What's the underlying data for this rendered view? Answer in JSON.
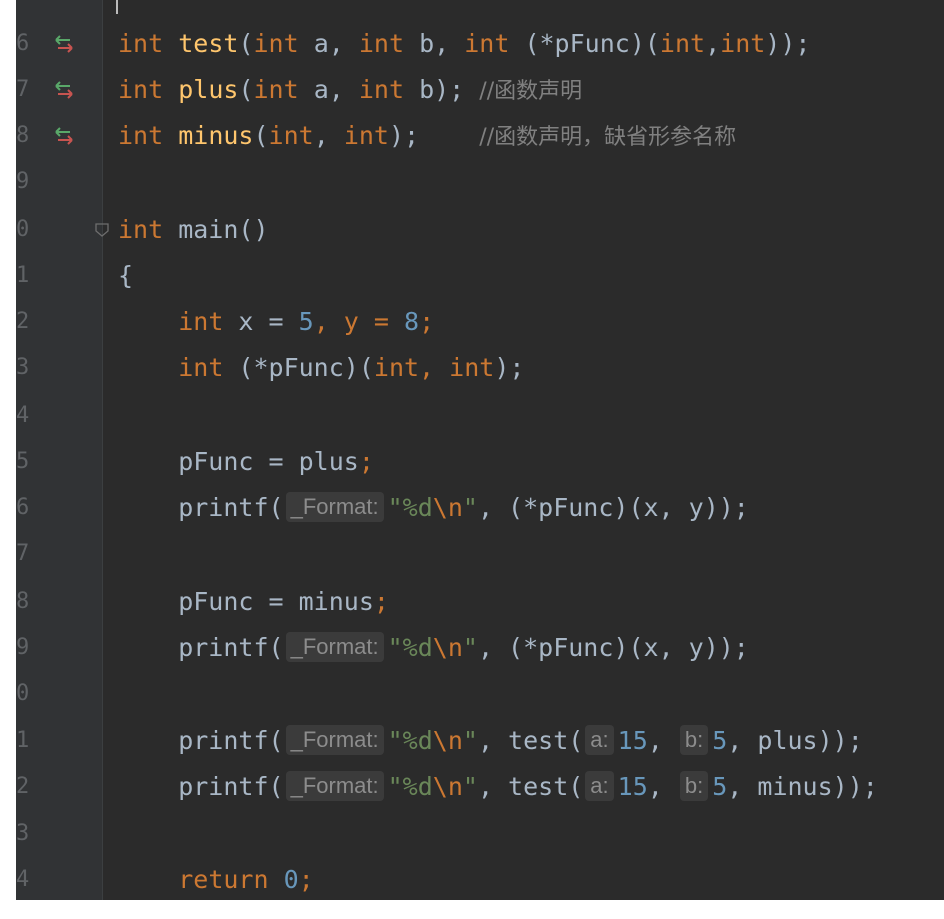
{
  "gutter": {
    "line_numbers": [
      "6",
      "7",
      "8",
      "9",
      "0",
      "1",
      "2",
      "3",
      "4",
      "5",
      "6",
      "7",
      "8",
      "9",
      "0",
      "1",
      "2",
      "3",
      "4"
    ]
  },
  "code": {
    "l6": {
      "t1": "int",
      "t2": " ",
      "t3": "test",
      "t4": "(",
      "t5": "int",
      "t6": " a, ",
      "t7": "int",
      "t8": " b, ",
      "t9": "int",
      "t10": " (*pFunc)(",
      "t11": "int",
      "t12": ",",
      "t13": "int",
      "t14": "));"
    },
    "l7": {
      "t1": "int",
      "t2": " ",
      "t3": "plus",
      "t4": "(",
      "t5": "int",
      "t6": " a, ",
      "t7": "int",
      "t8": " b); ",
      "t9": "//函数声明"
    },
    "l8": {
      "t1": "int",
      "t2": " ",
      "t3": "minus",
      "t4": "(",
      "t5": "int",
      "t6": ", ",
      "t7": "int",
      "t8": ");    ",
      "t9": "//函数声明，缺省形参名称"
    },
    "l10": {
      "t1": "int",
      "t2": " main()"
    },
    "l11": {
      "t1": "{"
    },
    "l12": {
      "t1": "    ",
      "t2": "int",
      "t3": " x = ",
      "t4": "5",
      "t5": ", y = ",
      "t6": "8",
      "t7": ";"
    },
    "l13": {
      "t1": "    ",
      "t2": "int",
      "t3": " (*pFunc)(",
      "t4": "int",
      "t5": ", ",
      "t6": "int",
      "t7": ");"
    },
    "l15": {
      "t1": "    pFunc = plus",
      "t2": ";"
    },
    "l16": {
      "t1": "    printf(",
      "hint": "_Format:",
      "t2": "\"%d",
      "t3": "\\n",
      "t4": "\"",
      "t5": ", (*pFunc)(x, y));"
    },
    "l18": {
      "t1": "    pFunc = minus",
      "t2": ";"
    },
    "l19": {
      "t1": "    printf(",
      "hint": "_Format:",
      "t2": "\"%d",
      "t3": "\\n",
      "t4": "\"",
      "t5": ", (*pFunc)(x, y));"
    },
    "l21": {
      "t1": "    printf(",
      "hint": "_Format:",
      "t2": "\"%d",
      "t3": "\\n",
      "t4": "\"",
      "t5": ", test(",
      "hint_a": "a:",
      "t6": "15",
      "t7": ", ",
      "hint_b": "b:",
      "t8": "5",
      "t9": ", plus));"
    },
    "l22": {
      "t1": "    printf(",
      "hint": "_Format:",
      "t2": "\"%d",
      "t3": "\\n",
      "t4": "\"",
      "t5": ", test(",
      "hint_a": "a:",
      "t6": "15",
      "t7": ", ",
      "hint_b": "b:",
      "t8": "5",
      "t9": ", minus));"
    },
    "l24": {
      "t1": "    ",
      "t2": "return",
      "t3": " ",
      "t4": "0",
      "t5": ";"
    }
  },
  "icons": {
    "gutter_marker": "implementation-arrows-icon",
    "fold_marker": "fold-icon"
  },
  "colors": {
    "keyword": "#cc7832",
    "function": "#ffc66d",
    "number": "#6897bb",
    "string": "#6a8759",
    "comment": "#808080",
    "text": "#a9b7c6",
    "background": "#2b2b2b"
  }
}
